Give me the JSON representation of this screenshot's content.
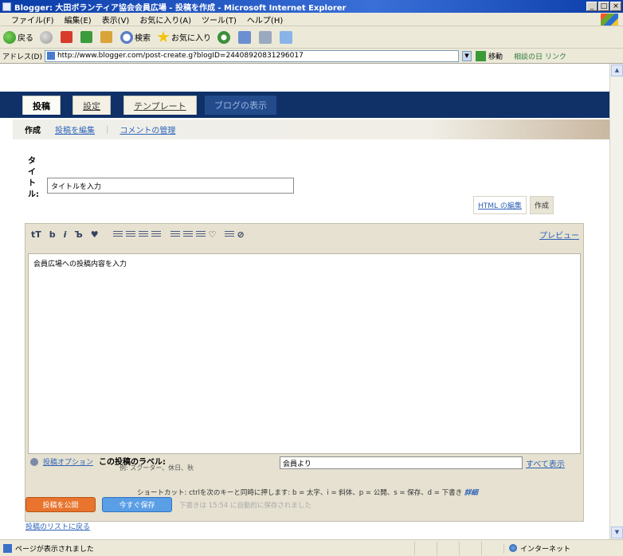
{
  "window": {
    "title": "Blogger: 大田ボランティア協会会員広場 - 投稿を作成 - Microsoft Internet Explorer",
    "controls": [
      "_",
      "□",
      "×"
    ]
  },
  "menu": [
    "ファイル(F)",
    "編集(E)",
    "表示(V)",
    "お気に入り(A)",
    "ツール(T)",
    "ヘルプ(H)"
  ],
  "toolbar": {
    "back": "戻る",
    "search": "検索",
    "favorites": "お気に入り"
  },
  "address": {
    "label": "アドレス(D)",
    "url": "http://www.blogger.com/post-create.g?blogID=24408920831296017",
    "go": "移動",
    "links": "相談の日 リンク"
  },
  "blog_nav": {
    "tabs": [
      "投稿",
      "設定",
      "テンプレート",
      "ブログの表示"
    ]
  },
  "subnav": {
    "active": "作成",
    "edit_posts": "投稿を編集",
    "moderate_comments": "コメントの管理"
  },
  "post": {
    "title_label": "タイトル:",
    "title_value": "タイトルを入力",
    "mode_html": "HTML の編集",
    "mode_compose": "作成",
    "preview": "プレビュー",
    "body": "会員広場への投稿内容を入力",
    "options_link": "投稿オプション",
    "labels_label": "この投稿のラベル:",
    "labels_hint": "例: スクーター、休日、秋",
    "labels_value": "会員より",
    "show_all": "すべて表示",
    "shortcut_text": "ショートカット: ctrlを次のキーと同時に押します: b = 太字、i = 斜体、p = 公開、s = 保存、d = 下書き",
    "shortcut_more": "詳細"
  },
  "actions": {
    "publish": "投稿を公開",
    "save_now": "今すぐ保存",
    "draft_message": "下書きは 15:54 に自動的に保存されました",
    "back_to_list": "投稿のリストに戻る"
  },
  "editor_toolbar": [
    "tT",
    "b",
    "i"
  ],
  "status": {
    "text": "ページが表示されました",
    "zone": "インターネット"
  }
}
